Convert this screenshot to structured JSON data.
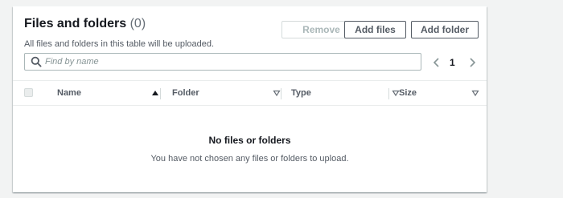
{
  "panel": {
    "title": "Files and folders",
    "count": "(0)",
    "description": "All files and folders in this table will be uploaded."
  },
  "buttons": {
    "remove": "Remove",
    "add_files": "Add files",
    "add_folder": "Add folder"
  },
  "search": {
    "placeholder": "Find by name",
    "value": ""
  },
  "pagination": {
    "current_page": "1"
  },
  "table": {
    "columns": [
      {
        "label": "Name",
        "sort": "ascending"
      },
      {
        "label": "Folder",
        "sort": "none"
      },
      {
        "label": "Type",
        "sort": "none"
      },
      {
        "label": "Size",
        "sort": "none"
      }
    ],
    "empty": {
      "title": "No files or folders",
      "text": "You have not chosen any files or folders to upload."
    }
  },
  "colors": {
    "background": "#f2f3f3",
    "panel": "#ffffff",
    "text": "#16191f",
    "muted": "#545b64",
    "disabled": "#aab7b8"
  },
  "icons": {
    "search": "search-icon",
    "prev": "chevron-left-icon",
    "next": "chevron-right-icon",
    "sort_active": "caret-up-filled-icon",
    "sort_inactive": "caret-down-outline-icon"
  }
}
